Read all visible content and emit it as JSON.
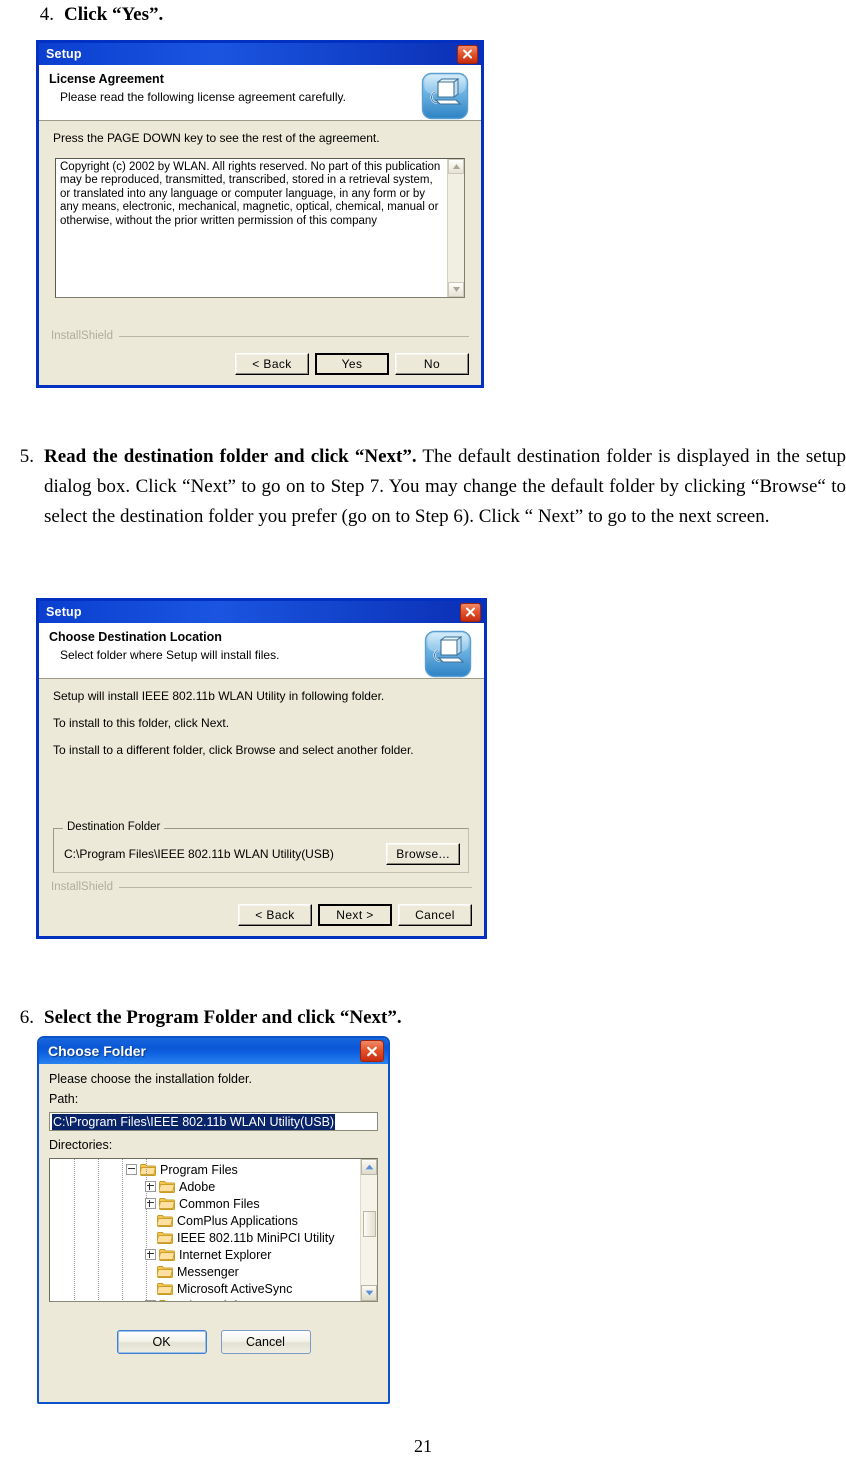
{
  "page": {
    "number": "21"
  },
  "steps": {
    "step4": {
      "number": "4.",
      "bold": "Click “Yes”.",
      "rest": ""
    },
    "step5": {
      "number": "5.",
      "bold": "Read the destination folder and click “Next”.",
      "rest": " The default destination folder is displayed in the setup dialog box.   Click “Next” to go on to Step 7. You may change the default folder by clicking “Browse“ to select the destination folder you prefer (go on to Step 6). Click “ Next” to go to the next screen."
    },
    "step6": {
      "number": "6.",
      "bold": "Select the Program Folder and click “Next”.",
      "rest": ""
    }
  },
  "license_dialog": {
    "title": "Setup",
    "close_label": "×",
    "header_title": "License Agreement",
    "header_subtitle": "Please read the following license agreement carefully.",
    "instruction": "Press the PAGE DOWN key to see the rest of the agreement.",
    "license_text": "Copyright (c) 2002 by WLAN. All rights reserved. No part of this publication may be reproduced, transmitted, transcribed, stored in a retrieval system, or translated into any language or computer language, in any form or by any means, electronic, mechanical, magnetic, optical, chemical, manual or otherwise, without the prior written permission of this company",
    "brand": "InstallShield",
    "buttons": {
      "back": "< Back",
      "yes": "Yes",
      "no": "No"
    }
  },
  "destination_dialog": {
    "title": "Setup",
    "close_label": "×",
    "header_title": "Choose Destination Location",
    "header_subtitle": "Select folder where Setup will install files.",
    "body_lines": [
      "Setup will install IEEE 802.11b WLAN Utility in following folder.",
      "To install to this folder, click Next.",
      "To install to a different folder, click Browse and select another folder."
    ],
    "group_label": "Destination Folder",
    "path": "C:\\Program Files\\IEEE 802.11b WLAN Utility(USB)",
    "browse_label": "Browse...",
    "brand": "InstallShield",
    "buttons": {
      "back": "< Back",
      "next": "Next >",
      "cancel": "Cancel"
    }
  },
  "choose_folder_dialog": {
    "title": "Choose Folder",
    "close_label": "×",
    "prompt": "Please choose the installation folder.",
    "path_label": "Path:",
    "path_value": "C:\\Program Files\\IEEE 802.11b WLAN Utility(USB)",
    "directories_label": "Directories:",
    "tree": [
      {
        "label": "Program Files",
        "depth": 0,
        "expander": "minus"
      },
      {
        "label": "Adobe",
        "depth": 1,
        "expander": "plus"
      },
      {
        "label": "Common Files",
        "depth": 1,
        "expander": "plus"
      },
      {
        "label": "ComPlus Applications",
        "depth": 1,
        "expander": "none"
      },
      {
        "label": "IEEE 802.11b MiniPCI Utility",
        "depth": 1,
        "expander": "none"
      },
      {
        "label": "Internet Explorer",
        "depth": 1,
        "expander": "plus"
      },
      {
        "label": "Messenger",
        "depth": 1,
        "expander": "none"
      },
      {
        "label": "Microsoft ActiveSync",
        "depth": 1,
        "expander": "none"
      },
      {
        "label": "microsoft frontpage",
        "depth": 1,
        "expander": "plus"
      }
    ],
    "buttons": {
      "ok": "OK",
      "cancel": "Cancel"
    }
  },
  "colors": {
    "title_blue": "#0b3fcf",
    "xp_title_blue": "#0f63e2",
    "dialog_face": "#ece9d8",
    "close_red": "#e4562c",
    "selection_blue": "#0a246a",
    "folder_yellow": "#fcd77f"
  }
}
